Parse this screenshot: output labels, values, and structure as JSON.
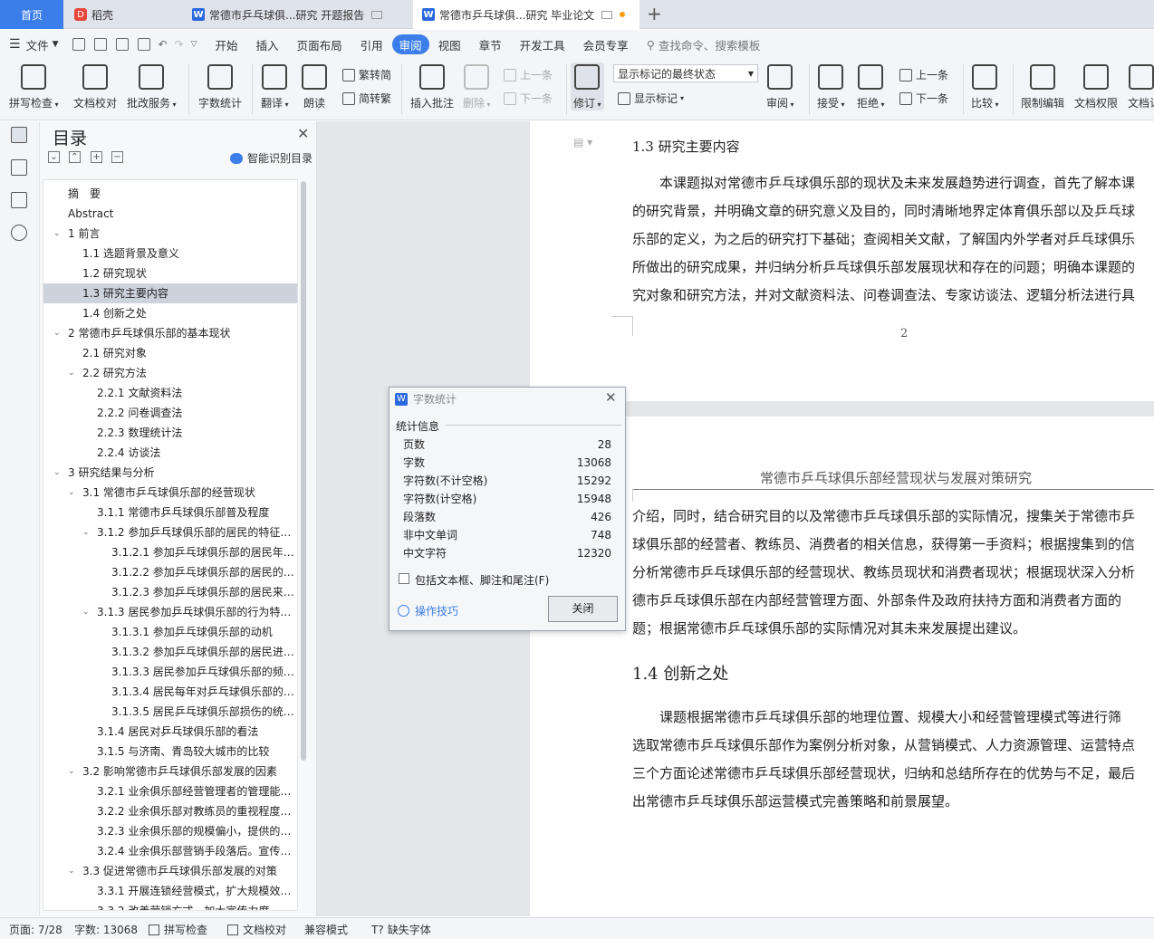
{
  "tabs": {
    "home": "首页",
    "daoke": "稻壳",
    "doc1": "常德市乒乓球俱...研究 开题报告",
    "doc2": "常德市乒乓球俱...研究 毕业论文",
    "new": "+"
  },
  "menu": {
    "file": "文件",
    "items": [
      "开始",
      "插入",
      "页面布局",
      "引用",
      "审阅",
      "视图",
      "章节",
      "开发工具",
      "会员专享"
    ],
    "search": "查找命令、搜索模板"
  },
  "ribbon": {
    "spellcheck": "拼写检查",
    "doccheck": "文档校对",
    "batch": "批改服务",
    "wordcount": "字数统计",
    "translate": "翻译",
    "read": "朗读",
    "t2s": "繁转简",
    "s2t": "简转繁",
    "insert_comment": "插入批注",
    "delete": "删除",
    "prev_c": "上一条",
    "next_c": "下一条",
    "revise": "修订",
    "state": "显示标记的最终状态",
    "show_marks": "显示标记",
    "review": "审阅",
    "accept": "接受",
    "reject": "拒绝",
    "prev": "上一条",
    "next": "下一条",
    "compare": "比较",
    "restrict": "限制编辑",
    "rights": "文档权限",
    "docauth": "文档认"
  },
  "toc": {
    "title": "目录",
    "smart": "智能识别目录",
    "items": [
      {
        "t": "摘　要",
        "lv": 0,
        "c": false
      },
      {
        "t": "Abstract",
        "lv": 0,
        "c": false
      },
      {
        "t": "1 前言",
        "lv": 0,
        "c": true
      },
      {
        "t": "1.1 选题背景及意义",
        "lv": 1,
        "c": false
      },
      {
        "t": "1.2 研究现状",
        "lv": 1,
        "c": false
      },
      {
        "t": "1.3 研究主要内容",
        "lv": 1,
        "c": false
      },
      {
        "t": "1.4 创新之处",
        "lv": 1,
        "c": false
      },
      {
        "t": "2 常德市乒乓球俱乐部的基本现状",
        "lv": 0,
        "c": true
      },
      {
        "t": "2.1 研究对象",
        "lv": 1,
        "c": false
      },
      {
        "t": "2.2 研究方法",
        "lv": 1,
        "c": true
      },
      {
        "t": "2.2.1 文献资料法",
        "lv": 2,
        "c": false
      },
      {
        "t": "2.2.2 问卷调查法",
        "lv": 2,
        "c": false
      },
      {
        "t": "2.2.3 数理统计法",
        "lv": 2,
        "c": false
      },
      {
        "t": "2.2.4 访谈法",
        "lv": 2,
        "c": false
      },
      {
        "t": "3 研究结果与分析",
        "lv": 0,
        "c": true
      },
      {
        "t": "3.1 常德市乒乓球俱乐部的经营现状",
        "lv": 1,
        "c": true
      },
      {
        "t": "3.1.1 常德市乒乓球俱乐部普及程度",
        "lv": 2,
        "c": false
      },
      {
        "t": "3.1.2 参加乒乓球俱乐部的居民的特征…",
        "lv": 2,
        "c": true
      },
      {
        "t": "3.1.2.1 参加乒乓球俱乐部的居民年…",
        "lv": 3,
        "c": false
      },
      {
        "t": "3.1.2.2 参加乒乓球俱乐部的居民的…",
        "lv": 3,
        "c": false
      },
      {
        "t": "3.1.2.3 参加乒乓球俱乐部的居民来…",
        "lv": 3,
        "c": false
      },
      {
        "t": "3.1.3 居民参加乒乓球俱乐部的行为特…",
        "lv": 2,
        "c": true
      },
      {
        "t": "3.1.3.1 参加乒乓球俱乐部的动机",
        "lv": 3,
        "c": false
      },
      {
        "t": "3.1.3.2 参加乒乓球俱乐部的居民进…",
        "lv": 3,
        "c": false
      },
      {
        "t": "3.1.3.3 居民参加乒乓球俱乐部的频…",
        "lv": 3,
        "c": false
      },
      {
        "t": "3.1.3.4 居民每年对乒乓球俱乐部的…",
        "lv": 3,
        "c": false
      },
      {
        "t": "3.1.3.5 居民乒乓球俱乐部损伤的统…",
        "lv": 3,
        "c": false
      },
      {
        "t": "3.1.4 居民对乒乓球俱乐部的看法",
        "lv": 2,
        "c": false
      },
      {
        "t": "3.1.5 与济南、青岛较大城市的比较",
        "lv": 2,
        "c": false
      },
      {
        "t": "3.2 影响常德市乒乓球俱乐部发展的因素",
        "lv": 1,
        "c": true
      },
      {
        "t": "3.2.1 业余俱乐部经营管理者的管理能…",
        "lv": 2,
        "c": false
      },
      {
        "t": "3.2.2 业余俱乐部对教练员的重视程度…",
        "lv": 2,
        "c": false
      },
      {
        "t": "3.2.3 业余俱乐部的规模偏小，提供的…",
        "lv": 2,
        "c": false
      },
      {
        "t": "3.2.4 业余俱乐部营销手段落后。宣传…",
        "lv": 2,
        "c": false
      },
      {
        "t": "3.3 促进常德市乒乓球俱乐部发展的对策",
        "lv": 1,
        "c": true
      },
      {
        "t": "3.3.1 开展连锁经营模式，扩大规模效…",
        "lv": 2,
        "c": false
      },
      {
        "t": "3.3.2 改善营销方式，加大宣传力度…",
        "lv": 2,
        "c": false
      }
    ],
    "selected": 5
  },
  "doc": {
    "heading13": "1.3 研究主要内容",
    "p1": [
      "　　本课题拟对常德市乒乓球俱乐部的现状及未来发展趋势进行调查，首先了解本课",
      "的研究背景，并明确文章的研究意义及目的，同时清晰地界定体育俱乐部以及乒乓球",
      "乐部的定义，为之后的研究打下基础；查阅相关文献，了解国内外学者对乒乓球俱乐",
      "所做出的研究成果，并归纳分析乒乓球俱乐部发展现状和存在的问题；明确本课题的",
      "究对象和研究方法，并对文献资料法、问卷调查法、专家访谈法、逻辑分析法进行具"
    ],
    "pagenum": "2",
    "header": "常德市乒乓球俱乐部经营现状与发展对策研究",
    "p2": [
      "介绍，同时，结合研究目的以及常德市乒乓球俱乐部的实际情况，搜集关于常德市乒",
      "球俱乐部的经营者、教练员、消费者的相关信息，获得第一手资料；根据搜集到的信",
      "分析常德市乒乓球俱乐部的经营现状、教练员现状和消费者现状；根据现状深入分析",
      "德市乒乓球俱乐部在内部经营管理方面、外部条件及政府扶持方面和消费者方面的",
      "题；根据常德市乒乓球俱乐部的实际情况对其未来发展提出建议。"
    ],
    "heading14": "1.4 创新之处",
    "p3": [
      "　　课题根据常德市乒乓球俱乐部的地理位置、规模大小和经营管理模式等进行筛",
      "选取常德市乒乓球俱乐部作为案例分析对象，从营销模式、人力资源管理、运营特点",
      "三个方面论述常德市乒乓球俱乐部经营现状，归纳和总结所存在的优势与不足，最后",
      "出常德市乒乓球俱乐部运营模式完善策略和前景展望。"
    ]
  },
  "dialog": {
    "title": "字数统计",
    "section": "统计信息",
    "stats": [
      {
        "k": "页数",
        "v": "28"
      },
      {
        "k": "字数",
        "v": "13068"
      },
      {
        "k": "字符数(不计空格)",
        "v": "15292"
      },
      {
        "k": "字符数(计空格)",
        "v": "15948"
      },
      {
        "k": "段落数",
        "v": "426"
      },
      {
        "k": "非中文单词",
        "v": "748"
      },
      {
        "k": "中文字符",
        "v": "12320"
      }
    ],
    "include": "包括文本框、脚注和尾注(F)",
    "tips": "操作技巧",
    "close": "关闭"
  },
  "status": {
    "page": "页面: 7/28",
    "words": "字数: 13068",
    "spell": "拼写检查",
    "check": "文档校对",
    "compat": "兼容模式",
    "font": "缺失字体"
  }
}
